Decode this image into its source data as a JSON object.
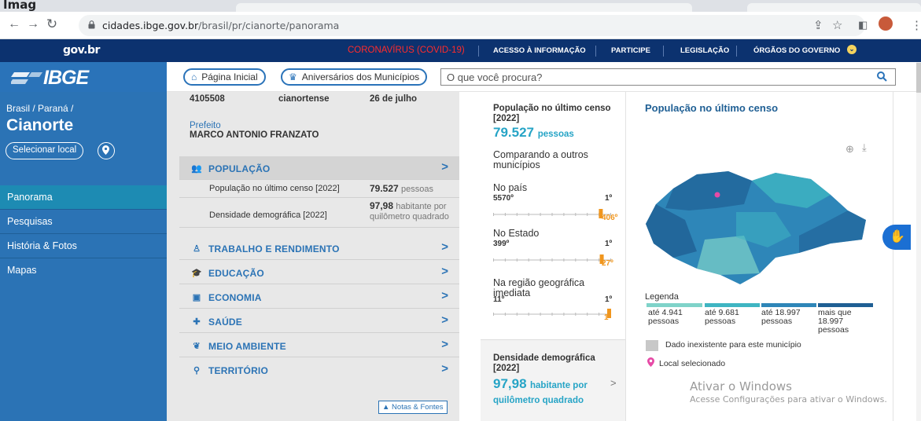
{
  "browser": {
    "tab_text": "Imag",
    "url_host": "cidades.ibge.gov.br",
    "url_path": "/brasil/pr/cianorte/panorama"
  },
  "govbar": {
    "logo": "gov.br",
    "links": [
      "CORONAVÍRUS (COVID-19)",
      "ACESSO À INFORMAÇÃO",
      "PARTICIPE",
      "LEGISLAÇÃO",
      "ÓRGÃOS DO GOVERNO"
    ]
  },
  "header": {
    "logo": "IBGE",
    "home_label": "Página Inicial",
    "anniversaries_label": "Aniversários dos Municípios",
    "search_placeholder": "O que você procura?"
  },
  "sidebar": {
    "breadcrumb": "Brasil / Paraná /",
    "city": "Cianorte",
    "select_label": "Selecionar local",
    "items": [
      {
        "label": "Panorama"
      },
      {
        "label": "Pesquisas"
      },
      {
        "label": "História & Fotos"
      },
      {
        "label": "Mapas"
      }
    ]
  },
  "middle": {
    "code": "4105508",
    "gentile": "cianortense",
    "anniversary": "26 de julho",
    "mayor_label": "Prefeito",
    "mayor_name": "MARCO ANTONIO FRANZATO",
    "categories": [
      {
        "label": "POPULAÇÃO",
        "icon": "people-icon"
      },
      {
        "label": "TRABALHO E RENDIMENTO",
        "icon": "worker-icon"
      },
      {
        "label": "EDUCAÇÃO",
        "icon": "graduation-icon"
      },
      {
        "label": "ECONOMIA",
        "icon": "money-icon"
      },
      {
        "label": "SAÚDE",
        "icon": "health-icon"
      },
      {
        "label": "MEIO AMBIENTE",
        "icon": "leaf-icon"
      },
      {
        "label": "TERRITÓRIO",
        "icon": "pin-icon"
      }
    ],
    "population_rows": [
      {
        "label": "População no último censo [2022]",
        "value": "79.527",
        "unit": "pessoas"
      },
      {
        "label": "Densidade demográfica [2022]",
        "value": "97,98",
        "unit": "habitante por quilômetro quadrado"
      }
    ],
    "notes_label": "Notas & Fontes"
  },
  "census_card": {
    "title": "População no último censo [2022]",
    "value": "79.527",
    "unit": "pessoas",
    "compare": "Comparando a outros municípios",
    "rankings": [
      {
        "label": "No país",
        "total": "5570º",
        "first": "1º",
        "position": "406º",
        "fraction": 0.927
      },
      {
        "label": "No Estado",
        "total": "399º",
        "first": "1º",
        "position": "27º",
        "fraction": 0.935
      },
      {
        "label": "Na região geográfica imediata",
        "total": "11º",
        "first": "1º",
        "position": "1º",
        "fraction": 1.0
      }
    ]
  },
  "density_card": {
    "title": "Densidade demográfica [2022]",
    "value": "97,98",
    "unit": "habitante por quilômetro quadrado"
  },
  "map": {
    "title": "População no último censo",
    "legend_title": "Legenda",
    "legend": [
      {
        "label": "até 4.941 pessoas",
        "color": "#7fd3c9"
      },
      {
        "label": "até 9.681 pessoas",
        "color": "#3fb5c2"
      },
      {
        "label": "até 18.997 pessoas",
        "color": "#2e86b8"
      },
      {
        "label": "mais que 18.997 pessoas",
        "color": "#1f5f94"
      }
    ],
    "missing_label": "Dado inexistente para este município",
    "selected_label": "Local selecionado"
  },
  "watermark": {
    "title": "Ativar o Windows",
    "subtitle": "Acesse Configurações para ativar o Windows."
  },
  "colors": {
    "gov_blue": "#0c326f",
    "ibge_blue": "#2a73b9",
    "accent_teal": "#26a4c6",
    "rank_orange": "#f0961e",
    "covid_red": "#ff2b2b"
  }
}
